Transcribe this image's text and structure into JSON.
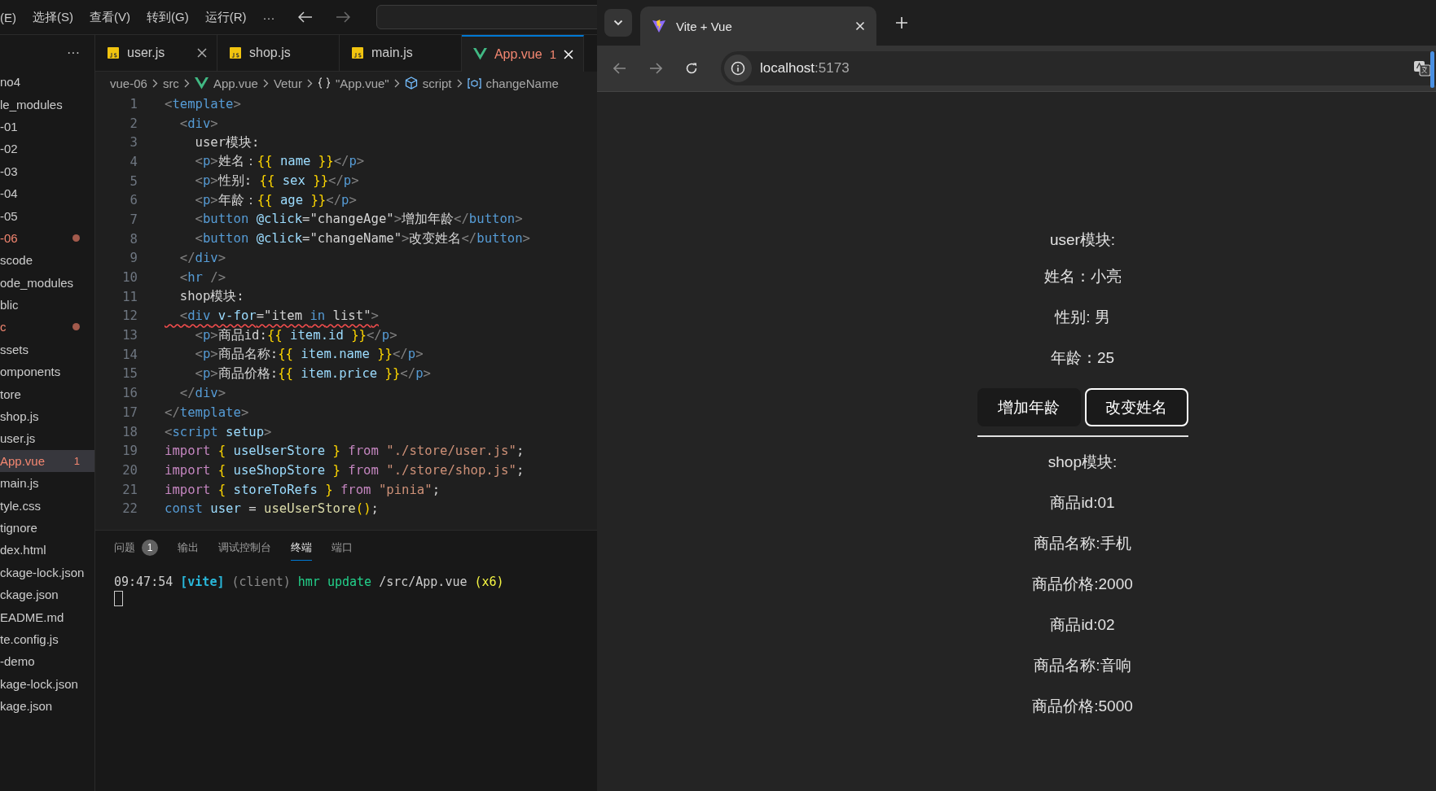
{
  "menu_bar": {
    "items": [
      "(E)",
      "选择(S)",
      "查看(V)",
      "转到(G)",
      "运行(R)",
      "···"
    ]
  },
  "explorer": {
    "more": "···",
    "items": [
      {
        "label": "no4",
        "modified": false,
        "selected": false
      },
      {
        "label": "le_modules",
        "modified": false,
        "selected": false
      },
      {
        "label": "-01",
        "modified": false,
        "selected": false
      },
      {
        "label": "-02",
        "modified": false,
        "selected": false
      },
      {
        "label": "-03",
        "modified": false,
        "selected": false
      },
      {
        "label": "-04",
        "modified": false,
        "selected": false
      },
      {
        "label": "-05",
        "modified": false,
        "selected": false
      },
      {
        "label": "-06",
        "modified": true,
        "selected": false
      },
      {
        "label": "scode",
        "modified": false,
        "selected": false
      },
      {
        "label": "ode_modules",
        "modified": false,
        "selected": false
      },
      {
        "label": "blic",
        "modified": false,
        "selected": false
      },
      {
        "label": "c",
        "modified": true,
        "selected": false
      },
      {
        "label": "ssets",
        "modified": false,
        "selected": false
      },
      {
        "label": "omponents",
        "modified": false,
        "selected": false
      },
      {
        "label": "tore",
        "modified": false,
        "selected": false
      },
      {
        "label": "shop.js",
        "modified": false,
        "selected": false
      },
      {
        "label": "user.js",
        "modified": false,
        "selected": false
      },
      {
        "label": "App.vue",
        "modified": true,
        "badge": "1",
        "selected": true
      },
      {
        "label": "main.js",
        "modified": false,
        "selected": false
      },
      {
        "label": "tyle.css",
        "modified": false,
        "selected": false
      },
      {
        "label": "tignore",
        "modified": false,
        "selected": false
      },
      {
        "label": "dex.html",
        "modified": false,
        "selected": false
      },
      {
        "label": "ckage-lock.json",
        "modified": false,
        "selected": false
      },
      {
        "label": "ckage.json",
        "modified": false,
        "selected": false
      },
      {
        "label": "EADME.md",
        "modified": false,
        "selected": false
      },
      {
        "label": "te.config.js",
        "modified": false,
        "selected": false
      },
      {
        "label": "-demo",
        "modified": false,
        "selected": false
      },
      {
        "label": "kage-lock.json",
        "modified": false,
        "selected": false
      },
      {
        "label": "kage.json",
        "modified": false,
        "selected": false
      }
    ]
  },
  "editor_tabs": [
    {
      "label": "user.js",
      "kind": "js",
      "selected": false,
      "close_shown": true
    },
    {
      "label": "shop.js",
      "kind": "js",
      "selected": false,
      "close_shown": false
    },
    {
      "label": "main.js",
      "kind": "js",
      "selected": false,
      "close_shown": false
    },
    {
      "label": "App.vue",
      "kind": "vue",
      "selected": true,
      "badge": "1",
      "close_shown": true
    }
  ],
  "breadcrumb": [
    {
      "text": "vue-06",
      "kind": "plain"
    },
    {
      "text": "src",
      "kind": "plain"
    },
    {
      "text": "App.vue",
      "kind": "vue"
    },
    {
      "text": "Vetur",
      "kind": "plain"
    },
    {
      "text": "\"App.vue\"",
      "kind": "braces"
    },
    {
      "text": "script",
      "kind": "module"
    },
    {
      "text": "changeName",
      "kind": "field"
    }
  ],
  "code": {
    "lines": [
      {
        "number": "1",
        "tokens": [
          {
            "text": "<",
            "kind": "punct"
          },
          {
            "text": "template",
            "kind": "tag"
          },
          {
            "text": ">",
            "kind": "punct"
          }
        ]
      },
      {
        "number": "2",
        "tokens": [
          {
            "text": "  <",
            "kind": "punct"
          },
          {
            "text": "div",
            "kind": "tag"
          },
          {
            "text": ">",
            "kind": "punct"
          }
        ]
      },
      {
        "number": "3",
        "tokens": [
          {
            "text": "    user模块:",
            "kind": "text"
          }
        ]
      },
      {
        "number": "4",
        "tokens": [
          {
            "text": "    <",
            "kind": "punct"
          },
          {
            "text": "p",
            "kind": "tag"
          },
          {
            "text": ">",
            "kind": "punct"
          },
          {
            "text": "姓名：",
            "kind": "text"
          },
          {
            "text": "{{",
            "kind": "mustache"
          },
          {
            "text": " name ",
            "kind": "var"
          },
          {
            "text": "}}",
            "kind": "mustache"
          },
          {
            "text": "</",
            "kind": "punct"
          },
          {
            "text": "p",
            "kind": "tag"
          },
          {
            "text": ">",
            "kind": "punct"
          }
        ]
      },
      {
        "number": "5",
        "tokens": [
          {
            "text": "    <",
            "kind": "punct"
          },
          {
            "text": "p",
            "kind": "tag"
          },
          {
            "text": ">",
            "kind": "punct"
          },
          {
            "text": "性别: ",
            "kind": "text"
          },
          {
            "text": "{{",
            "kind": "mustache"
          },
          {
            "text": " sex ",
            "kind": "var"
          },
          {
            "text": "}}",
            "kind": "mustache"
          },
          {
            "text": "</",
            "kind": "punct"
          },
          {
            "text": "p",
            "kind": "tag"
          },
          {
            "text": ">",
            "kind": "punct"
          }
        ]
      },
      {
        "number": "6",
        "tokens": [
          {
            "text": "    <",
            "kind": "punct"
          },
          {
            "text": "p",
            "kind": "tag"
          },
          {
            "text": ">",
            "kind": "punct"
          },
          {
            "text": "年龄：",
            "kind": "text"
          },
          {
            "text": "{{",
            "kind": "mustache"
          },
          {
            "text": " age ",
            "kind": "var"
          },
          {
            "text": "}}",
            "kind": "mustache"
          },
          {
            "text": "</",
            "kind": "punct"
          },
          {
            "text": "p",
            "kind": "tag"
          },
          {
            "text": ">",
            "kind": "punct"
          }
        ]
      },
      {
        "number": "7",
        "tokens": [
          {
            "text": "    <",
            "kind": "punct"
          },
          {
            "text": "button",
            "kind": "tag"
          },
          {
            "text": " @click",
            "kind": "attr"
          },
          {
            "text": "=\"changeAge\"",
            "kind": "text"
          },
          {
            "text": ">",
            "kind": "punct"
          },
          {
            "text": "增加年龄",
            "kind": "text"
          },
          {
            "text": "</",
            "kind": "punct"
          },
          {
            "text": "button",
            "kind": "tag"
          },
          {
            "text": ">",
            "kind": "punct"
          }
        ]
      },
      {
        "number": "8",
        "tokens": [
          {
            "text": "    <",
            "kind": "punct"
          },
          {
            "text": "button",
            "kind": "tag"
          },
          {
            "text": " @click",
            "kind": "attr"
          },
          {
            "text": "=\"changeName\"",
            "kind": "text"
          },
          {
            "text": ">",
            "kind": "punct"
          },
          {
            "text": "改变姓名",
            "kind": "text"
          },
          {
            "text": "</",
            "kind": "punct"
          },
          {
            "text": "button",
            "kind": "tag"
          },
          {
            "text": ">",
            "kind": "punct"
          }
        ]
      },
      {
        "number": "9",
        "tokens": [
          {
            "text": "  </",
            "kind": "punct"
          },
          {
            "text": "div",
            "kind": "tag"
          },
          {
            "text": ">",
            "kind": "punct"
          }
        ]
      },
      {
        "number": "10",
        "tokens": [
          {
            "text": "  <",
            "kind": "punct"
          },
          {
            "text": "hr",
            "kind": "tag"
          },
          {
            "text": " />",
            "kind": "punct"
          }
        ]
      },
      {
        "number": "11",
        "tokens": [
          {
            "text": "  shop模块:",
            "kind": "text"
          }
        ]
      },
      {
        "number": "12",
        "error": true,
        "tokens": [
          {
            "text": "  <",
            "kind": "punct"
          },
          {
            "text": "div",
            "kind": "tag"
          },
          {
            "text": " v-for",
            "kind": "attr"
          },
          {
            "text": "=\"item ",
            "kind": "text"
          },
          {
            "text": "in",
            "kind": "storage"
          },
          {
            "text": " list\"",
            "kind": "text"
          },
          {
            "text": ">",
            "kind": "punct"
          }
        ]
      },
      {
        "number": "13",
        "tokens": [
          {
            "text": "    <",
            "kind": "punct"
          },
          {
            "text": "p",
            "kind": "tag"
          },
          {
            "text": ">",
            "kind": "punct"
          },
          {
            "text": "商品id:",
            "kind": "text"
          },
          {
            "text": "{{",
            "kind": "mustache"
          },
          {
            "text": " item.id ",
            "kind": "var"
          },
          {
            "text": "}}",
            "kind": "mustache"
          },
          {
            "text": "</",
            "kind": "punct"
          },
          {
            "text": "p",
            "kind": "tag"
          },
          {
            "text": ">",
            "kind": "punct"
          }
        ]
      },
      {
        "number": "14",
        "tokens": [
          {
            "text": "    <",
            "kind": "punct"
          },
          {
            "text": "p",
            "kind": "tag"
          },
          {
            "text": ">",
            "kind": "punct"
          },
          {
            "text": "商品名称:",
            "kind": "text"
          },
          {
            "text": "{{",
            "kind": "mustache"
          },
          {
            "text": " item.name ",
            "kind": "var"
          },
          {
            "text": "}}",
            "kind": "mustache"
          },
          {
            "text": "</",
            "kind": "punct"
          },
          {
            "text": "p",
            "kind": "tag"
          },
          {
            "text": ">",
            "kind": "punct"
          }
        ]
      },
      {
        "number": "15",
        "tokens": [
          {
            "text": "    <",
            "kind": "punct"
          },
          {
            "text": "p",
            "kind": "tag"
          },
          {
            "text": ">",
            "kind": "punct"
          },
          {
            "text": "商品价格:",
            "kind": "text"
          },
          {
            "text": "{{",
            "kind": "mustache"
          },
          {
            "text": " item.price ",
            "kind": "var"
          },
          {
            "text": "}}",
            "kind": "mustache"
          },
          {
            "text": "</",
            "kind": "punct"
          },
          {
            "text": "p",
            "kind": "tag"
          },
          {
            "text": ">",
            "kind": "punct"
          }
        ]
      },
      {
        "number": "16",
        "tokens": [
          {
            "text": "  </",
            "kind": "punct"
          },
          {
            "text": "div",
            "kind": "tag"
          },
          {
            "text": ">",
            "kind": "punct"
          }
        ]
      },
      {
        "number": "17",
        "tokens": [
          {
            "text": "</",
            "kind": "punct"
          },
          {
            "text": "template",
            "kind": "tag"
          },
          {
            "text": ">",
            "kind": "punct"
          }
        ]
      },
      {
        "number": "18",
        "tokens": [
          {
            "text": "<",
            "kind": "punct"
          },
          {
            "text": "script",
            "kind": "tag"
          },
          {
            "text": " setup",
            "kind": "attr"
          },
          {
            "text": ">",
            "kind": "punct"
          }
        ]
      },
      {
        "number": "19",
        "tokens": [
          {
            "text": "import ",
            "kind": "keyword"
          },
          {
            "text": "{",
            "kind": "brace"
          },
          {
            "text": " useUserStore ",
            "kind": "var"
          },
          {
            "text": "}",
            "kind": "brace"
          },
          {
            "text": " from ",
            "kind": "keyword"
          },
          {
            "text": "\"./store/user.js\"",
            "kind": "string"
          },
          {
            "text": ";",
            "kind": "text"
          }
        ]
      },
      {
        "number": "20",
        "tokens": [
          {
            "text": "import ",
            "kind": "keyword"
          },
          {
            "text": "{",
            "kind": "brace"
          },
          {
            "text": " useShopStore ",
            "kind": "var"
          },
          {
            "text": "}",
            "kind": "brace"
          },
          {
            "text": " from ",
            "kind": "keyword"
          },
          {
            "text": "\"./store/shop.js\"",
            "kind": "string"
          },
          {
            "text": ";",
            "kind": "text"
          }
        ]
      },
      {
        "number": "21",
        "tokens": [
          {
            "text": "import ",
            "kind": "keyword"
          },
          {
            "text": "{",
            "kind": "brace"
          },
          {
            "text": " storeToRefs ",
            "kind": "var"
          },
          {
            "text": "}",
            "kind": "brace"
          },
          {
            "text": " from ",
            "kind": "keyword"
          },
          {
            "text": "\"pinia\"",
            "kind": "string"
          },
          {
            "text": ";",
            "kind": "text"
          }
        ]
      },
      {
        "number": "22",
        "tokens": [
          {
            "text": "const ",
            "kind": "storage"
          },
          {
            "text": "user",
            "kind": "var"
          },
          {
            "text": " = ",
            "kind": "text"
          },
          {
            "text": "useUserStore",
            "kind": "func"
          },
          {
            "text": "()",
            "kind": "brace"
          },
          {
            "text": ";",
            "kind": "text"
          }
        ]
      }
    ]
  },
  "panel": {
    "tabs": [
      {
        "label": "问题",
        "badge": "1",
        "selected": false
      },
      {
        "label": "输出",
        "selected": false
      },
      {
        "label": "调试控制台",
        "selected": false
      },
      {
        "label": "终端",
        "selected": true
      },
      {
        "label": "端口",
        "selected": false
      }
    ],
    "terminal": [
      {
        "text": "09:47:54 ",
        "kind": "plain"
      },
      {
        "text": "[vite]",
        "kind": "vite"
      },
      {
        "text": " (client) ",
        "kind": "dim"
      },
      {
        "text": "hmr update ",
        "kind": "green"
      },
      {
        "text": "/src/App.vue ",
        "kind": "plain"
      },
      {
        "text": "(x6)",
        "kind": "yellow"
      }
    ]
  },
  "browser": {
    "tab": {
      "title": "Vite + Vue"
    },
    "url": {
      "host": "localhost",
      "port": ":5173"
    },
    "page": {
      "user_heading": "user模块:",
      "fields": [
        "姓名：小亮",
        "性别: 男",
        "年龄：25"
      ],
      "buttons": [
        {
          "label": "增加年龄",
          "focused": false
        },
        {
          "label": "改变姓名",
          "focused": true
        }
      ],
      "shop_heading": "shop模块:",
      "product_lines": [
        "商品id:01",
        "商品名称:手机",
        "商品价格:2000",
        "商品id:02",
        "商品名称:音响",
        "商品价格:5000"
      ]
    }
  }
}
